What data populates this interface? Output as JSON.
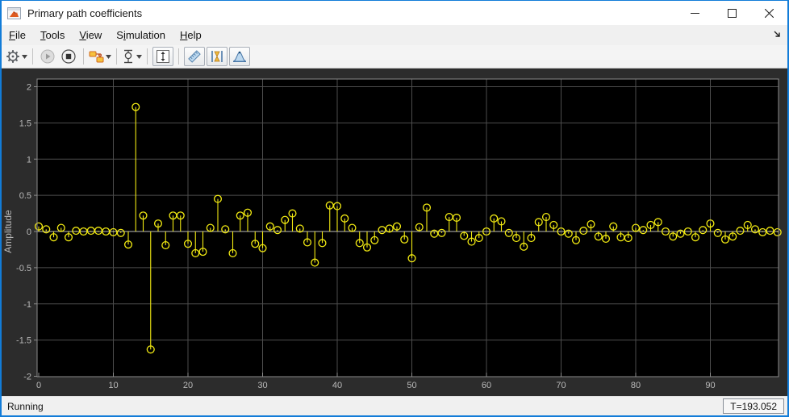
{
  "window": {
    "title": "Primary path coefficients",
    "controls": [
      "minimize",
      "maximize",
      "close"
    ]
  },
  "menu": {
    "items": [
      {
        "id": "file",
        "label": "File",
        "underline": 0
      },
      {
        "id": "tools",
        "label": "Tools",
        "underline": 0
      },
      {
        "id": "view",
        "label": "View",
        "underline": 0
      },
      {
        "id": "simulation",
        "label": "Simulation",
        "underline": 1
      },
      {
        "id": "help",
        "label": "Help",
        "underline": 0
      }
    ]
  },
  "toolbar": {
    "buttons": [
      "settings-gear",
      "run",
      "stop",
      "simulink-blocks",
      "scale-axes",
      "fit-to-view",
      "cursor-measurements",
      "triggers",
      "peak-finder"
    ]
  },
  "chart_data": {
    "type": "stem",
    "title": "",
    "xlabel": "",
    "ylabel": "Amplitude",
    "x_start": 0,
    "x_step": 1,
    "values": [
      0.07,
      0.03,
      -0.08,
      0.05,
      -0.08,
      0.01,
      0.0,
      0.01,
      0.01,
      0.0,
      -0.01,
      -0.02,
      -0.18,
      1.72,
      0.22,
      -1.63,
      0.11,
      -0.19,
      0.22,
      0.22,
      -0.17,
      -0.3,
      -0.28,
      0.05,
      0.45,
      0.03,
      -0.3,
      0.22,
      0.26,
      -0.17,
      -0.23,
      0.07,
      0.02,
      0.16,
      0.25,
      0.04,
      -0.15,
      -0.43,
      -0.16,
      0.36,
      0.35,
      0.18,
      0.05,
      -0.16,
      -0.22,
      -0.12,
      0.02,
      0.04,
      0.07,
      -0.11,
      -0.37,
      0.06,
      0.33,
      -0.03,
      -0.02,
      0.2,
      0.19,
      -0.06,
      -0.14,
      -0.09,
      0.0,
      0.18,
      0.14,
      -0.02,
      -0.09,
      -0.21,
      -0.09,
      0.13,
      0.2,
      0.09,
      0.0,
      -0.03,
      -0.12,
      0.01,
      0.1,
      -0.07,
      -0.1,
      0.07,
      -0.08,
      -0.09,
      0.05,
      0.02,
      0.09,
      0.13,
      0.0,
      -0.07,
      -0.03,
      0.0,
      -0.08,
      0.02,
      0.11,
      -0.02,
      -0.11,
      -0.07,
      0.01,
      0.09,
      0.03,
      -0.01,
      0.01,
      -0.01
    ],
    "xlim": [
      0,
      99.2
    ],
    "ylim": [
      -2,
      2.11
    ],
    "xticks": [
      0,
      10,
      20,
      30,
      40,
      50,
      60,
      70,
      80,
      90
    ],
    "yticks": [
      -2,
      -1.5,
      -1,
      -0.5,
      0,
      0.5,
      1,
      1.5,
      2
    ],
    "grid": true,
    "legend": null,
    "line_color": "#f2ea12",
    "plot_bg": "#000000",
    "figure_bg": "#2c2c2c",
    "grid_color": "#4d4d4d",
    "zero_line_color": "#969696",
    "box_color": "#8c8c8c",
    "tick_label_color": "#b9b9b9"
  },
  "status": {
    "state": "Running",
    "time": "T=193.052"
  }
}
